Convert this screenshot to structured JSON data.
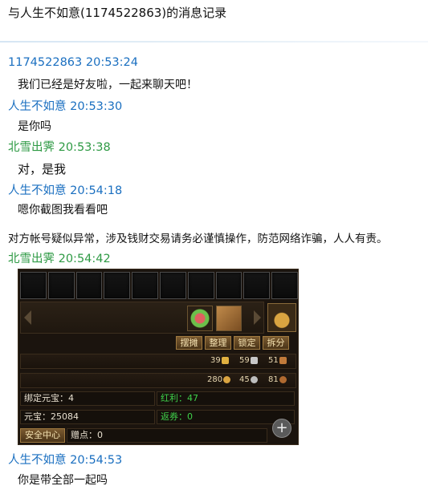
{
  "window": {
    "title": "与人生不如意(1174522863)的消息记录"
  },
  "messages": [
    {
      "sender": "1174522863",
      "time": "20:53:24",
      "text": "我们已经是好友啦，一起来聊天吧！",
      "color": "#1a6fc0"
    },
    {
      "sender": "人生不如意",
      "time": "20:53:30",
      "text": "是你吗",
      "color": "#1a6fc0"
    },
    {
      "sender": "北雪出霁",
      "time": "20:53:38",
      "text": "对，是我",
      "color": "#2e9a44"
    },
    {
      "sender": "人生不如意",
      "time": "20:54:18",
      "text": "嗯你截图我看看吧",
      "color": "#1a6fc0"
    },
    {
      "sender": "北雪出霁",
      "time": "20:54:42",
      "text": "",
      "color": "#2e9a44"
    },
    {
      "sender": "人生不如意",
      "time": "20:54:53",
      "text": "你是带全部一起吗",
      "color": "#1a6fc0"
    }
  ],
  "system_notice": "对方帐号疑似异常，涉及钱财交易请务必谨慎操作，防范网络诈骗，人人有责。",
  "game_screenshot": {
    "buttons": [
      "摆摊",
      "整理",
      "锁定",
      "拆分"
    ],
    "currency_row_1": [
      {
        "value": "39",
        "icon": "gold-ingot-icon"
      },
      {
        "value": "59",
        "icon": "silver-ingot-icon"
      },
      {
        "value": "51",
        "icon": "copper-ingot-icon"
      }
    ],
    "currency_row_2": [
      {
        "value": "280",
        "icon": "gold-coin-icon"
      },
      {
        "value": "45",
        "icon": "silver-coin-icon"
      },
      {
        "value": "81",
        "icon": "copper-coin-icon"
      }
    ],
    "stats": {
      "bound_yuanbao": "绑定元宝：4",
      "bonus": "红利：47",
      "yuanbao": "元宝：25084",
      "rebate": "返券：0",
      "safe_center": "安全中心",
      "points": "赠点：0"
    }
  },
  "colors": {
    "blue_sender": "#1a6fc0",
    "green_sender": "#2e9a44"
  }
}
